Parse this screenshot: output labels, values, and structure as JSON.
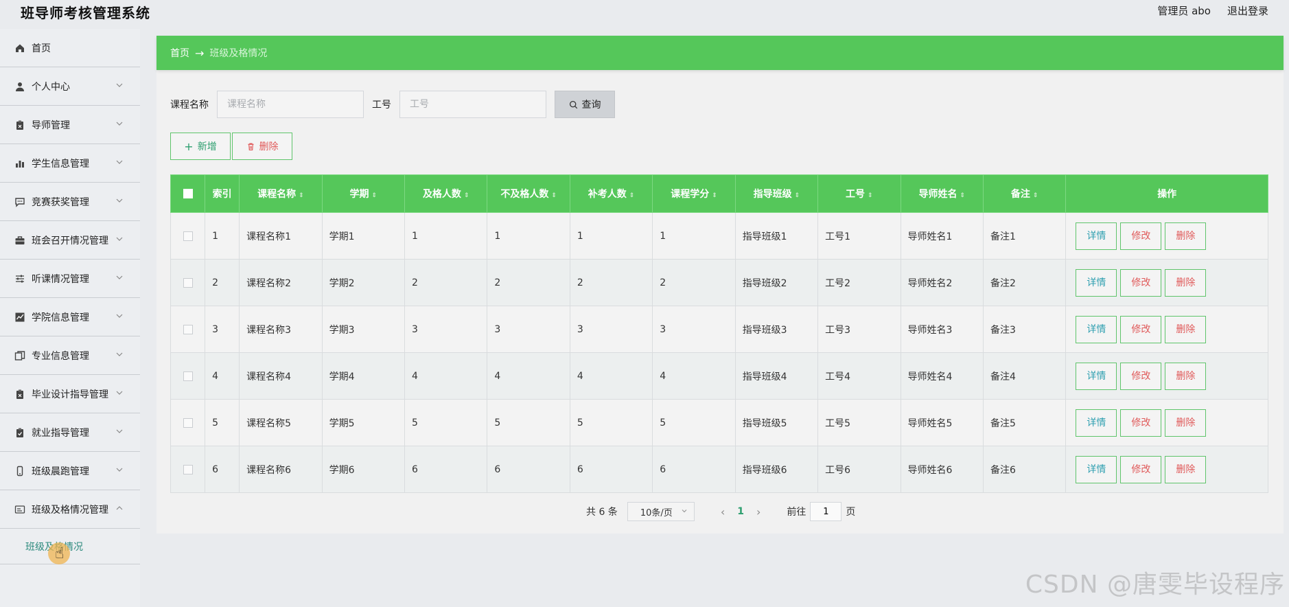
{
  "header": {
    "title": "班导师考核管理系统",
    "user_label": "管理员 abo",
    "logout": "退出登录"
  },
  "sidebar": {
    "items": [
      {
        "label": "首页",
        "icon": "home-icon"
      },
      {
        "label": "个人中心",
        "icon": "user-icon"
      },
      {
        "label": "导师管理",
        "icon": "clipboard-icon"
      },
      {
        "label": "学生信息管理",
        "icon": "bar-chart-icon"
      },
      {
        "label": "竞赛获奖管理",
        "icon": "chat-icon"
      },
      {
        "label": "班会召开情况管理",
        "icon": "briefcase-icon"
      },
      {
        "label": "听课情况管理",
        "icon": "sliders-icon"
      },
      {
        "label": "学院信息管理",
        "icon": "line-chart-icon"
      },
      {
        "label": "专业信息管理",
        "icon": "copy-icon"
      },
      {
        "label": "毕业设计指导管理",
        "icon": "clipboard-icon"
      },
      {
        "label": "就业指导管理",
        "icon": "clipboard-check-icon"
      },
      {
        "label": "班级晨跑管理",
        "icon": "phone-icon"
      },
      {
        "label": "班级及格情况管理",
        "icon": "card-icon"
      }
    ],
    "subitem": "班级及格情况"
  },
  "breadcrumb": {
    "home": "首页",
    "arrow": "→",
    "current": "班级及格情况"
  },
  "search": {
    "course_label": "课程名称",
    "course_placeholder": "课程名称",
    "id_label": "工号",
    "id_placeholder": "工号",
    "query_button": "查询"
  },
  "actions": {
    "add": "新增",
    "delete": "删除"
  },
  "table": {
    "columns": [
      "索引",
      "课程名称",
      "学期",
      "及格人数",
      "不及格人数",
      "补考人数",
      "课程学分",
      "指导班级",
      "工号",
      "导师姓名",
      "备注",
      "操作"
    ],
    "rows": [
      [
        "1",
        "课程名称1",
        "学期1",
        "1",
        "1",
        "1",
        "1",
        "指导班级1",
        "工号1",
        "导师姓名1",
        "备注1"
      ],
      [
        "2",
        "课程名称2",
        "学期2",
        "2",
        "2",
        "2",
        "2",
        "指导班级2",
        "工号2",
        "导师姓名2",
        "备注2"
      ],
      [
        "3",
        "课程名称3",
        "学期3",
        "3",
        "3",
        "3",
        "3",
        "指导班级3",
        "工号3",
        "导师姓名3",
        "备注3"
      ],
      [
        "4",
        "课程名称4",
        "学期4",
        "4",
        "4",
        "4",
        "4",
        "指导班级4",
        "工号4",
        "导师姓名4",
        "备注4"
      ],
      [
        "5",
        "课程名称5",
        "学期5",
        "5",
        "5",
        "5",
        "5",
        "指导班级5",
        "工号5",
        "导师姓名5",
        "备注5"
      ],
      [
        "6",
        "课程名称6",
        "学期6",
        "6",
        "6",
        "6",
        "6",
        "指导班级6",
        "工号6",
        "导师姓名6",
        "备注6"
      ]
    ],
    "row_actions": {
      "detail": "详情",
      "edit": "修改",
      "remove": "删除"
    }
  },
  "pagination": {
    "total": "共 6 条",
    "page_size": "10条/页",
    "current_page": "1",
    "goto_label": "前往",
    "goto_value": "1",
    "page_unit": "页"
  },
  "watermark": "CSDN @唐雯毕设程序",
  "colors": {
    "primary_green": "#55c75a",
    "danger": "#e05a5a",
    "info": "#2f9fb0"
  }
}
